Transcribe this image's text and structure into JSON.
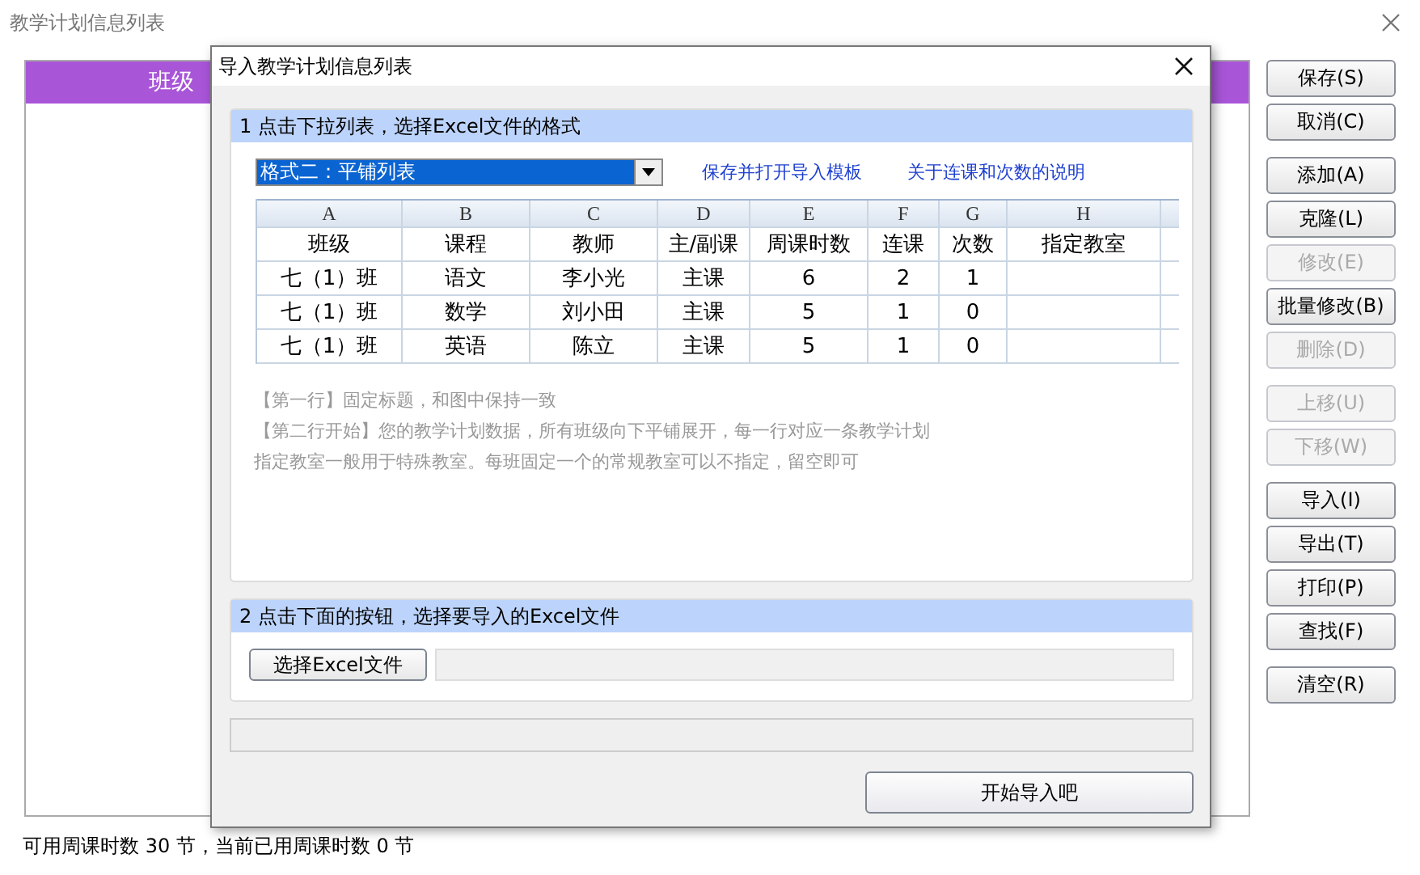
{
  "window": {
    "title": "教学计划信息列表"
  },
  "list_panel": {
    "header": "班级"
  },
  "button_groups": [
    [
      {
        "label": "保存(S)",
        "disabled": false
      },
      {
        "label": "取消(C)",
        "disabled": false
      }
    ],
    [
      {
        "label": "添加(A)",
        "disabled": false
      },
      {
        "label": "克隆(L)",
        "disabled": false
      },
      {
        "label": "修改(E)",
        "disabled": true
      },
      {
        "label": "批量修改(B)",
        "disabled": false
      },
      {
        "label": "删除(D)",
        "disabled": true
      }
    ],
    [
      {
        "label": "上移(U)",
        "disabled": true
      },
      {
        "label": "下移(W)",
        "disabled": true
      }
    ],
    [
      {
        "label": "导入(I)",
        "disabled": false
      },
      {
        "label": "导出(T)",
        "disabled": false
      },
      {
        "label": "打印(P)",
        "disabled": false
      },
      {
        "label": "查找(F)",
        "disabled": false
      }
    ],
    [
      {
        "label": "清空(R)",
        "disabled": false
      }
    ]
  ],
  "status_bar": "可用周课时数 30 节，当前已用周课时数 0 节",
  "dialog": {
    "title": "导入教学计划信息列表",
    "step1": {
      "header": "1 点击下拉列表，选择Excel文件的格式",
      "format_dropdown": {
        "value": "格式二：平铺列表"
      },
      "links": [
        "保存并打开导入模板",
        "关于连课和次数的说明"
      ],
      "sample_sheet": {
        "column_letters": [
          "A",
          "B",
          "C",
          "D",
          "E",
          "F",
          "G",
          "H"
        ],
        "rows": [
          [
            "班级",
            "课程",
            "教师",
            "主/副课",
            "周课时数",
            "连课",
            "次数",
            "指定教室"
          ],
          [
            "七（1）班",
            "语文",
            "李小光",
            "主课",
            "6",
            "2",
            "1"
          ],
          [
            "七（1）班",
            "数学",
            "刘小田",
            "主课",
            "5",
            "1",
            "0"
          ],
          [
            "七（1）班",
            "英语",
            "陈立",
            "主课",
            "5",
            "1",
            "0"
          ]
        ]
      },
      "notes": [
        "【第一行】固定标题，和图中保持一致",
        "【第二行开始】您的教学计划数据，所有班级向下平铺展开，每一行对应一条教学计划",
        "指定教室一般用于特殊教室。每班固定一个的常规教室可以不指定，留空即可"
      ]
    },
    "step2": {
      "header": "2 点击下面的按钮，选择要导入的Excel文件",
      "choose_button": "选择Excel文件"
    },
    "start_button": "开始导入吧"
  }
}
